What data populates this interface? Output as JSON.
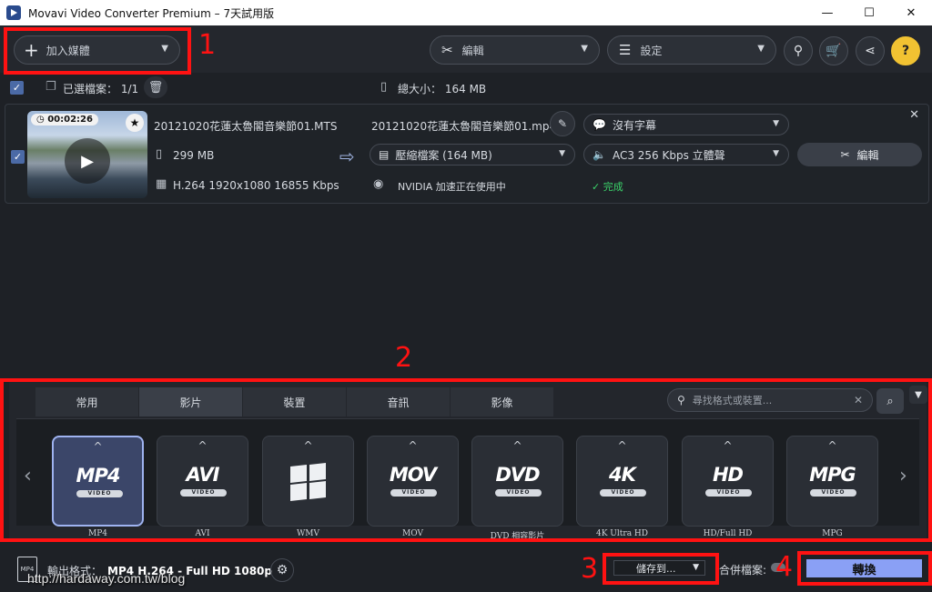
{
  "window": {
    "title": "Movavi Video Converter Premium – 7天試用版",
    "minimize": "—",
    "maximize": "☐",
    "close": "✕"
  },
  "toolbar": {
    "add_media": "加入媒體",
    "edit": "編輯",
    "settings": "設定"
  },
  "selection": {
    "selected_label": "已選檔案：",
    "selected_count": "1/1",
    "total_size_label": "總大小：",
    "total_size": "164 MB"
  },
  "file": {
    "duration": "00:02:26",
    "source_name": "20121020花蓮太魯閣音樂節01.MTS",
    "source_size": "299 MB",
    "source_info": "H.264 1920x1080 16855 Kbps",
    "output_name": "20121020花蓮太魯閣音樂節01.mp4",
    "compress": "壓縮檔案 (164 MB)",
    "gpu": "NVIDIA 加速正在使用中",
    "subtitle": "沒有字幕",
    "audio": "AC3 256 Kbps 立體聲",
    "edit": "編輯",
    "status": "完成"
  },
  "format_panel": {
    "tabs": [
      "常用",
      "影片",
      "裝置",
      "音訊",
      "影像"
    ],
    "active_tab": "影片",
    "search_placeholder": "尋找格式或裝置...",
    "formats": [
      {
        "logo": "MP4",
        "badge": "VIDEO",
        "label": "MP4",
        "selected": true
      },
      {
        "logo": "AVI",
        "badge": "VIDEO",
        "label": "AVI"
      },
      {
        "logo": "",
        "badge": "",
        "label": "WMV"
      },
      {
        "logo": "MOV",
        "badge": "VIDEO",
        "label": "MOV"
      },
      {
        "logo": "DVD",
        "badge": "VIDEO",
        "label": "DVD 相容影片"
      },
      {
        "logo": "4K",
        "badge": "VIDEO",
        "label": "4K Ultra HD"
      },
      {
        "logo": "HD",
        "badge": "VIDEO",
        "label": "HD/Full HD"
      },
      {
        "logo": "MPG",
        "badge": "VIDEO",
        "label": "MPG"
      }
    ]
  },
  "bottom": {
    "output_label": "輸出格式：",
    "output_value": "MP4 H.264 - Full HD 1080p",
    "output_icon_text": "MP4",
    "save_to": "儲存到...",
    "merge": "合併檔案:",
    "convert": "轉換",
    "watermark": "http://hardaway.com.tw/blog"
  },
  "annotations": [
    "1",
    "2",
    "3",
    "4"
  ],
  "colors": {
    "accent": "#4b6aa6",
    "convert": "#8aa0f5",
    "highlight": "#ff1212",
    "done": "#3bd36a",
    "help": "#f1c232"
  }
}
